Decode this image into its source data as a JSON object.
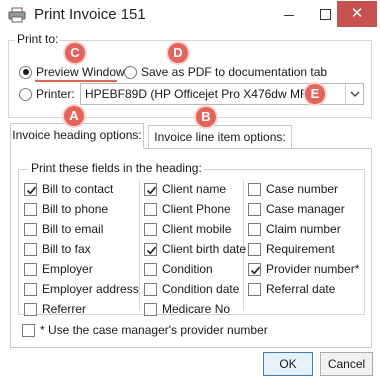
{
  "window": {
    "title": "Print Invoice 151",
    "minimize_label": "",
    "maximize_label": "",
    "close_label": "✕"
  },
  "print_to": {
    "legend": "Print to:",
    "preview_label": "Preview Window",
    "pdf_label": "Save as PDF to documentation tab",
    "printer_label": "Printer:",
    "printer_value": "HPEBF89D (HP Officejet Pro X476dw MFP)",
    "selected": "preview"
  },
  "tabs": [
    {
      "label": "Invoice heading options:",
      "active": true
    },
    {
      "label": "Invoice line item options:",
      "active": false
    }
  ],
  "heading_fields": {
    "legend": "Print these fields in the heading:",
    "columns": [
      [
        {
          "label": "Bill to contact",
          "checked": true
        },
        {
          "label": "Bill to phone",
          "checked": false
        },
        {
          "label": "Bill to email",
          "checked": false
        },
        {
          "label": "Bill to fax",
          "checked": false
        },
        {
          "label": "Employer",
          "checked": false
        },
        {
          "label": "Employer address",
          "checked": false
        },
        {
          "label": "Referrer",
          "checked": false
        }
      ],
      [
        {
          "label": "Client name",
          "checked": true
        },
        {
          "label": "Client Phone",
          "checked": false
        },
        {
          "label": "Client mobile",
          "checked": false
        },
        {
          "label": "Client birth date",
          "checked": true
        },
        {
          "label": "Condition",
          "checked": false
        },
        {
          "label": "Condition date",
          "checked": false
        },
        {
          "label": "Medicare No",
          "checked": false
        }
      ],
      [
        {
          "label": "Case number",
          "checked": false
        },
        {
          "label": "Case manager",
          "checked": false
        },
        {
          "label": "Claim number",
          "checked": false
        },
        {
          "label": "Requirement",
          "checked": false
        },
        {
          "label": "Provider number*",
          "checked": true
        },
        {
          "label": "Referral date",
          "checked": false
        }
      ]
    ],
    "footnote_label": "* Use the case manager's provider number",
    "footnote_checked": false
  },
  "buttons": {
    "ok": "OK",
    "cancel": "Cancel"
  },
  "markers": [
    "A",
    "B",
    "C",
    "D",
    "E"
  ],
  "colors": {
    "marker": "#e2645a",
    "close": "#c75050",
    "default_button": "#3c7fb1"
  }
}
